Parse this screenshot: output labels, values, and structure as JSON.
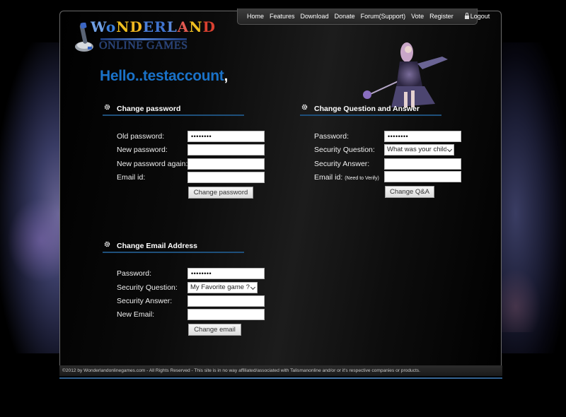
{
  "nav": {
    "items": [
      "Home",
      "Features",
      "Download",
      "Donate",
      "Forum(Support)",
      "Vote",
      "Register"
    ],
    "logout": "Logout"
  },
  "logo": {
    "title": "WONDERLAND",
    "subtitle": "ONLINE GAMES"
  },
  "greeting": {
    "text": "Hello..testaccount",
    "comma": ","
  },
  "change_password": {
    "title": "Change password",
    "fields": [
      {
        "label": "Old password:",
        "value": "••••••••"
      },
      {
        "label": "New password:",
        "value": ""
      },
      {
        "label": "New password again:",
        "value": ""
      },
      {
        "label": "Email id:",
        "value": ""
      }
    ],
    "button": "Change password"
  },
  "change_qa": {
    "title": "Change Question and Answer",
    "password_label": "Password:",
    "password_value": "••••••••",
    "question_label": "Security Question:",
    "question_selected": "What was your childhood",
    "answer_label": "Security Answer:",
    "answer_value": "",
    "email_label": "Email id:",
    "email_note": "(Need to Verify)",
    "email_value": "",
    "button": "Change Q&A"
  },
  "change_email": {
    "title": "Change Email Address",
    "password_label": "Password:",
    "password_value": "••••••••",
    "question_label": "Security Question:",
    "question_selected": "My Favorite game ?",
    "answer_label": "Security Answer:",
    "answer_value": "",
    "new_email_label": "New Email:",
    "new_email_value": "",
    "button": "Change email"
  },
  "footer": {
    "text": "©2012 by Wonderlandonlinegames.com - All Rights Reserved - This site is in no way affiliated/associated with Talismanonline and/or or it's respective companies or products."
  },
  "colors": {
    "accent": "#1a72c8",
    "section_rule": "#1e4f7a",
    "footer_rule": "#4d7fb2"
  }
}
